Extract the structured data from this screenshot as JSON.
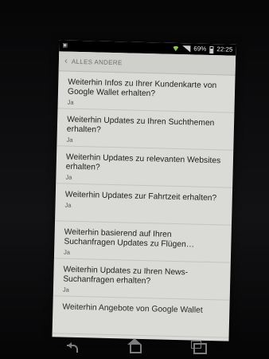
{
  "status_bar": {
    "notification_icon": "notification-icon",
    "battery_percent": "69%",
    "time": "22:25"
  },
  "action_bar": {
    "title": "ALLES ANDERE"
  },
  "items": [
    {
      "title": "Weiterhin Infos zu Ihrer Kundenkarte von Google Wallet erhalten?",
      "summary": "Ja"
    },
    {
      "title": "Weiterhin Updates zu Ihren Suchthemen erhalten?",
      "summary": "Ja"
    },
    {
      "title": "Weiterhin Updates zu relevanten Websites erhalten?",
      "summary": "Ja"
    },
    {
      "title": "Weiterhin Updates zur Fahrtzeit erhalten?",
      "summary": "Ja"
    },
    {
      "title": "Weiterhin basierend auf Ihren Suchanfragen Updates zu Flügen…",
      "summary": "Ja"
    },
    {
      "title": "Weiterhin Updates zu Ihren News-Suchanfragen erhalten?",
      "summary": "Ja"
    },
    {
      "title": "Weiterhin Angebote von Google Wallet",
      "summary": ""
    }
  ]
}
